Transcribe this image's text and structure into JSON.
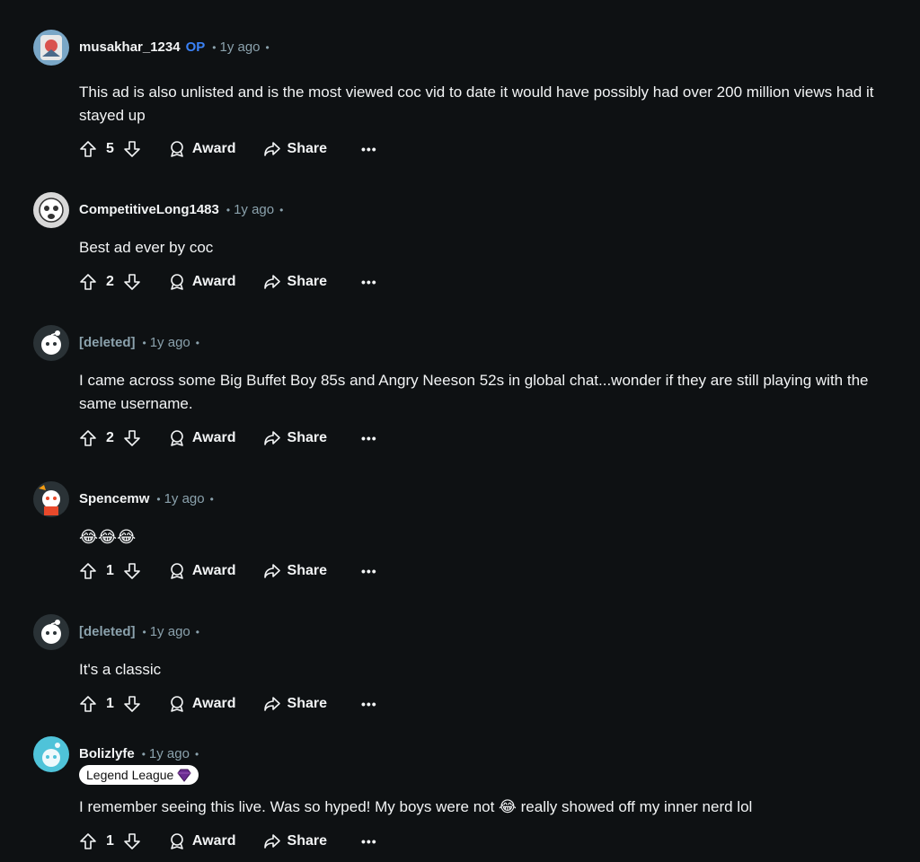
{
  "colors": {
    "background": "#0e1113",
    "text": "#f2f4f5",
    "muted": "#8ba2ad",
    "op_badge": "#3b82f6"
  },
  "comments": [
    {
      "username": "musakhar_1234",
      "op_label": "OP",
      "time": "1y ago",
      "body": "This ad is also unlisted and is the most viewed coc vid to date it would have possibly had over 200 million views had it stayed up",
      "votes": "5",
      "award_label": "Award",
      "share_label": "Share",
      "more_label": "•••"
    },
    {
      "username": "CompetitiveLong1483",
      "time": "1y ago",
      "body": "Best ad ever by coc",
      "votes": "2",
      "award_label": "Award",
      "share_label": "Share",
      "more_label": "•••"
    },
    {
      "username": "[deleted]",
      "time": "1y ago",
      "body": "I came across some Big Buffet Boy 85s and Angry Neeson 52s in global chat...wonder if they are still playing with the same username.",
      "votes": "2",
      "award_label": "Award",
      "share_label": "Share",
      "more_label": "•••"
    },
    {
      "username": "Spencemw",
      "time": "1y ago",
      "body": "😂😂😂",
      "votes": "1",
      "award_label": "Award",
      "share_label": "Share",
      "more_label": "•••"
    },
    {
      "username": "[deleted]",
      "time": "1y ago",
      "body": "It's a classic",
      "votes": "1",
      "award_label": "Award",
      "share_label": "Share",
      "more_label": "•••"
    },
    {
      "username": "Bolizlyfe",
      "time": "1y ago",
      "flair": "Legend League",
      "body": "I remember seeing this live. Was so hyped! My boys were not 😂 really showed off my inner nerd lol",
      "votes": "1",
      "award_label": "Award",
      "share_label": "Share",
      "more_label": "•••"
    }
  ]
}
